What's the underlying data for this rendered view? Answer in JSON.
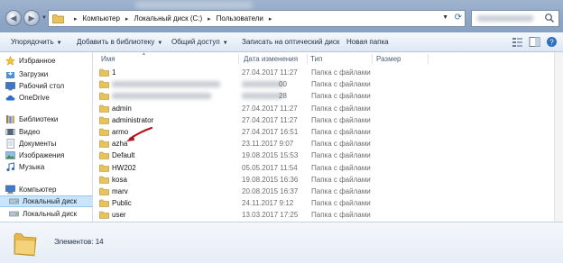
{
  "address": {
    "crumbs": [
      "Компьютер",
      "Локальный диск (C:)",
      "Пользователи"
    ]
  },
  "toolbar": {
    "organize": "Упорядочить",
    "add_library": "Добавить в библиотеку",
    "share": "Общий доступ",
    "burn": "Записать на оптический диск",
    "new_folder": "Новая папка"
  },
  "sidebar": {
    "items": [
      {
        "label": "Избранное",
        "icon": "star-icon"
      },
      {
        "label": "Загрузки",
        "icon": "downloads-icon"
      },
      {
        "label": "Рабочий стол",
        "icon": "desktop-icon"
      },
      {
        "label": "OneDrive",
        "icon": "onedrive-icon"
      },
      {
        "label": "Библиотеки",
        "icon": "libraries-icon"
      },
      {
        "label": "Видео",
        "icon": "video-icon"
      },
      {
        "label": "Документы",
        "icon": "documents-icon"
      },
      {
        "label": "Изображения",
        "icon": "images-icon"
      },
      {
        "label": "Музыка",
        "icon": "music-icon"
      },
      {
        "label": "Компьютер",
        "icon": "computer-icon"
      },
      {
        "label": "Локальный диск",
        "icon": "drive-icon"
      },
      {
        "label": "Локальный диск",
        "icon": "drive-icon"
      }
    ]
  },
  "columns": {
    "name": "Имя",
    "date": "Дата изменения",
    "type": "Тип",
    "size": "Размер"
  },
  "files": [
    {
      "name": "1",
      "date": "27.04.2017 11:27",
      "type": "Папка с файлами"
    },
    {
      "name": "",
      "date": "00",
      "type": "Папка с файлами"
    },
    {
      "name": "",
      "date": "28",
      "type": "Папка с файлами"
    },
    {
      "name": "admin",
      "date": "27.04.2017 11:27",
      "type": "Папка с файлами"
    },
    {
      "name": "administrator",
      "date": "27.04.2017 11:27",
      "type": "Папка с файлами"
    },
    {
      "name": "armo",
      "date": "27.04.2017 16:51",
      "type": "Папка с файлами"
    },
    {
      "name": "azha",
      "date": "23.11.2017 9:07",
      "type": "Папка с файлами"
    },
    {
      "name": "Default",
      "date": "19.08.2015 15:53",
      "type": "Папка с файлами"
    },
    {
      "name": "HW202",
      "date": "05.05.2017 11:54",
      "type": "Папка с файлами"
    },
    {
      "name": "kosa",
      "date": "19.08.2015 16:36",
      "type": "Папка с файлами"
    },
    {
      "name": "marv",
      "date": "20.08.2015 16:37",
      "type": "Папка с файлами"
    },
    {
      "name": "Public",
      "date": "24.11.2017 9:12",
      "type": "Папка с файлами"
    },
    {
      "name": "user",
      "date": "13.03.2017 17:25",
      "type": "Папка с файлами"
    },
    {
      "name": "Администратор",
      "date": "13.03.2017 17:27",
      "type": "Папка с файлами"
    }
  ],
  "status": {
    "count": "Элементов: 14"
  },
  "colors": {
    "accent": "#3a6fb0",
    "selection": "#cce4f7",
    "arrow": "#b3141c",
    "folder": "#e8c25a"
  }
}
